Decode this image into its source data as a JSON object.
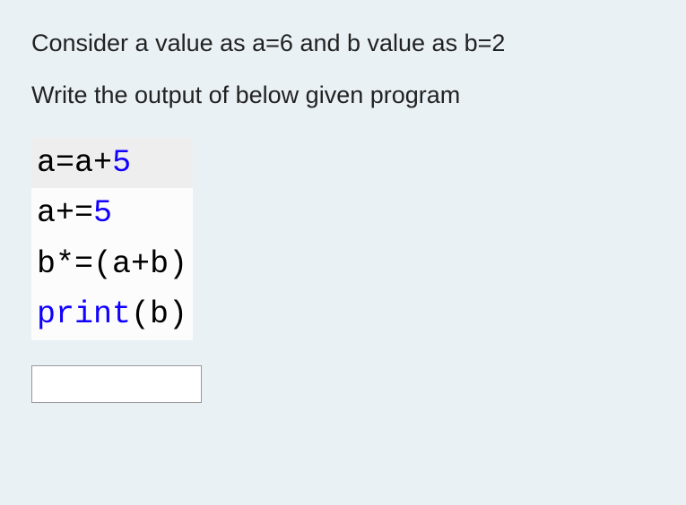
{
  "question": {
    "line1": "Consider a value as a=6 and b value as b=2",
    "line2": "Write the output of below given program"
  },
  "code": {
    "line1": {
      "p1": "a",
      "p2": "=",
      "p3": "a",
      "p4": "+",
      "p5": "5"
    },
    "line2": {
      "p1": "a",
      "p2": "+=",
      "p3": "5"
    },
    "line3": {
      "p1": "b",
      "p2": "*=",
      "p3": "(a",
      "p4": "+",
      "p5": "b)"
    },
    "line4": {
      "p1": "print",
      "p2": "(b)"
    }
  },
  "answer": {
    "value": ""
  }
}
